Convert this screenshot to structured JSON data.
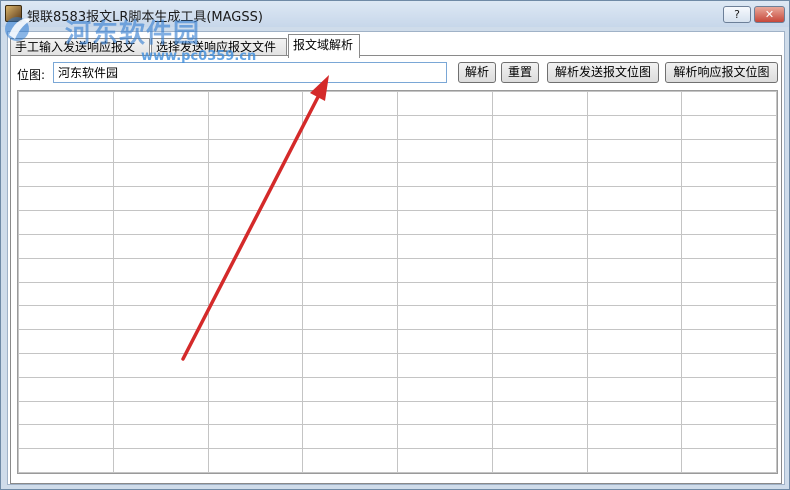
{
  "window": {
    "title": "银联8583报文LR脚本生成工具(MAGSS)",
    "help_label": "?",
    "close_label": "✕"
  },
  "watermark": {
    "logo_text": "河东软件园",
    "url": "www.pc0359.cn"
  },
  "tabs": [
    {
      "label": "手工输入发送响应报文",
      "active": false
    },
    {
      "label": "选择发送响应报文文件",
      "active": false
    },
    {
      "label": "报文域解析",
      "active": true
    }
  ],
  "form": {
    "bitmap_label": "位图:",
    "bitmap_value": "河东软件园"
  },
  "buttons": {
    "parse": "解析",
    "reset": "重置",
    "parse_send_bitmap": "解析发送报文位图",
    "parse_response_bitmap": "解析响应报文位图"
  },
  "grid": {
    "rows": 16,
    "cols": 8
  },
  "colors": {
    "arrow": "#d42a2a",
    "input_border": "#7aa7d6",
    "titlebar": "#c7d7ea"
  }
}
